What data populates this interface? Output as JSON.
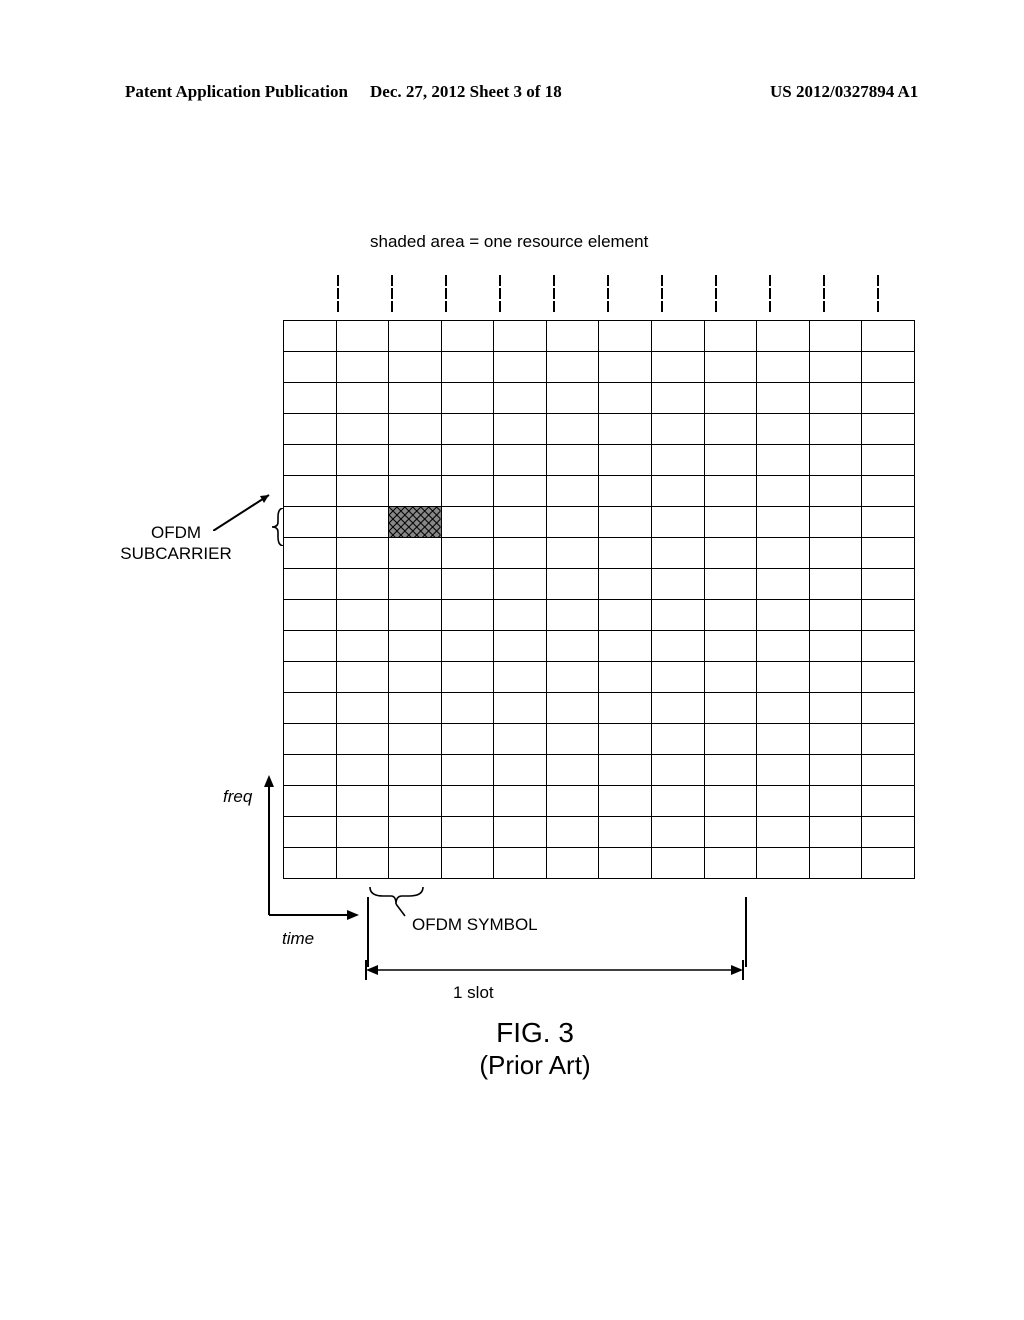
{
  "header": {
    "left": "Patent Application Publication",
    "mid": "Dec. 27, 2012  Sheet 3 of 18",
    "right": "US 2012/0327894 A1"
  },
  "caption_top": "shaded area = one resource element",
  "labels": {
    "subcarrier_line1": "OFDM",
    "subcarrier_line2": "SUBCARRIER",
    "freq": "freq",
    "time": "time",
    "ofdm_symbol": "OFDM SYMBOL",
    "slot": "1 slot",
    "figure": "FIG. 3",
    "prior_art": "(Prior Art)"
  },
  "chart_data": {
    "type": "heatmap",
    "title": "OFDM resource grid",
    "subtitle": "shaded area = one resource element",
    "xlabel": "time",
    "ylabel": "freq",
    "n_cols": 12,
    "n_rows": 18,
    "shaded_cells": [
      {
        "row": 6,
        "col": 2,
        "note": "one resource element"
      }
    ],
    "annotations": {
      "x_unit": "OFDM SYMBOL",
      "y_unit": "OFDM SUBCARRIER",
      "slot_span_symbols": 7,
      "slot_label": "1 slot"
    }
  }
}
